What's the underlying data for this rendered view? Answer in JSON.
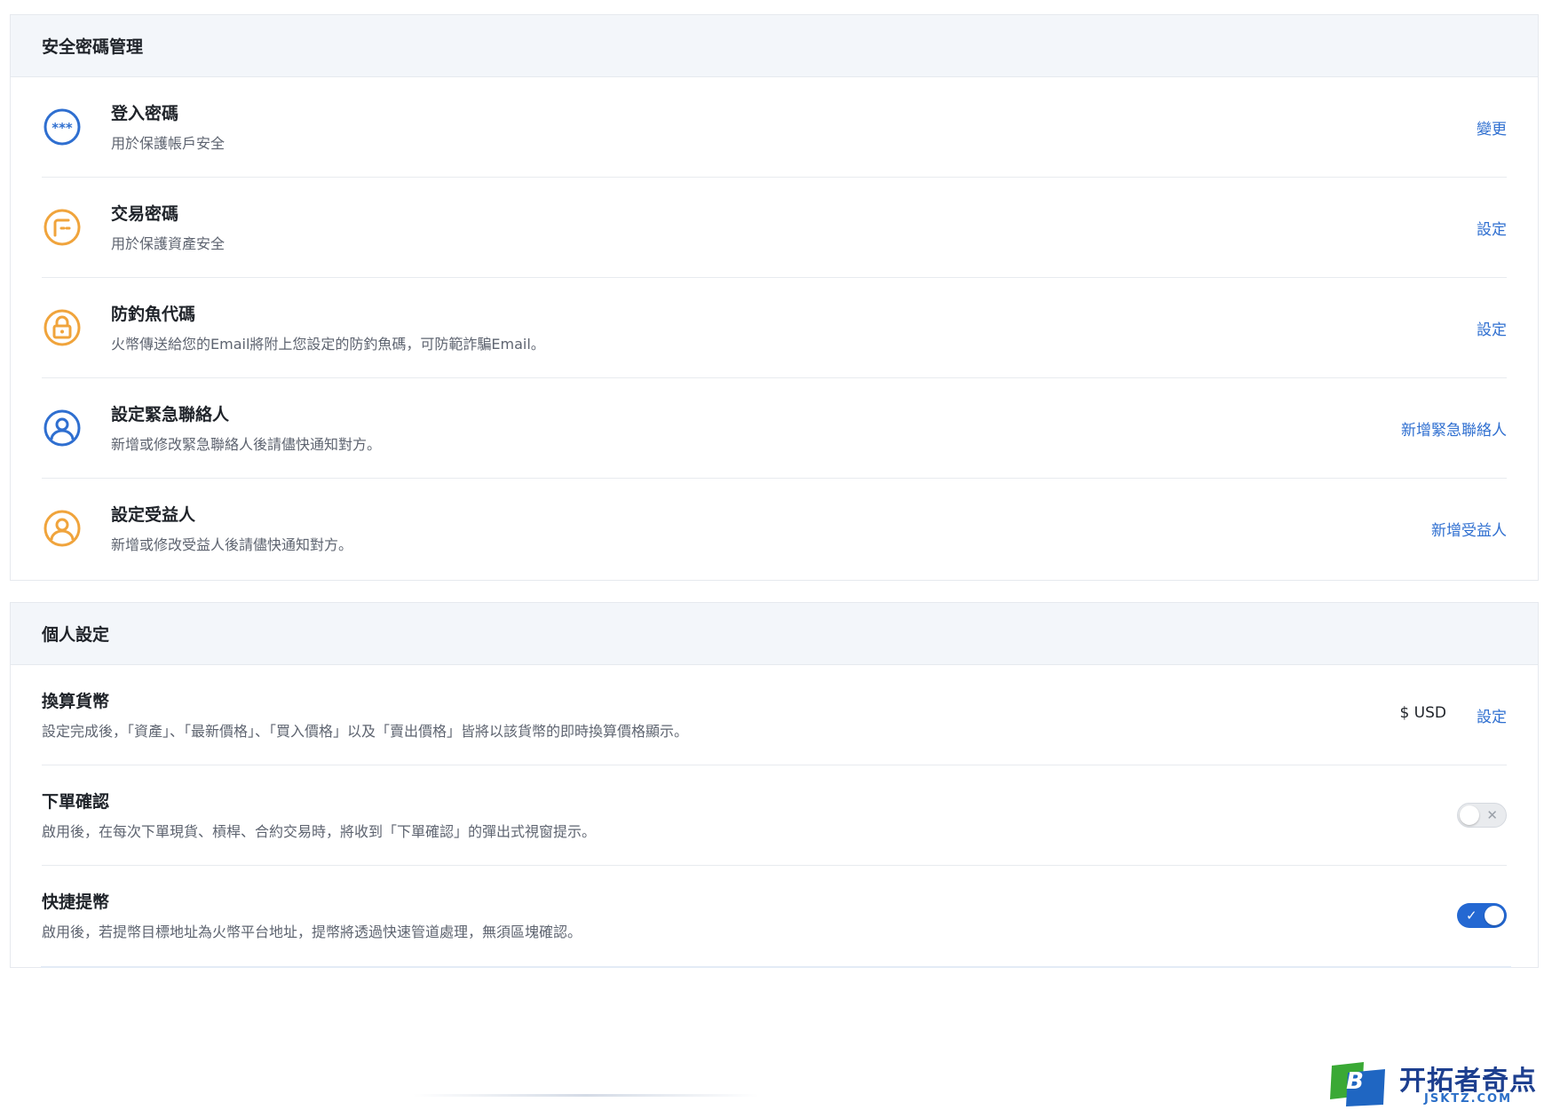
{
  "security": {
    "title": "安全密碼管理",
    "rows": [
      {
        "icon": "password-stars-icon",
        "title": "登入密碼",
        "desc": "用於保護帳戶安全",
        "action": "變更"
      },
      {
        "icon": "trade-password-icon",
        "title": "交易密碼",
        "desc": "用於保護資產安全",
        "action": "設定"
      },
      {
        "icon": "lock-icon",
        "title": "防釣魚代碼",
        "desc": "火幣傳送給您的Email將附上您設定的防釣魚碼，可防範詐騙Email。",
        "action": "設定"
      },
      {
        "icon": "user-icon",
        "title": "設定緊急聯絡人",
        "desc": "新增或修改緊急聯絡人後請儘快通知對方。",
        "action": "新增緊急聯絡人"
      },
      {
        "icon": "user-icon",
        "title": "設定受益人",
        "desc": "新增或修改受益人後請儘快通知對方。",
        "action": "新增受益人"
      }
    ]
  },
  "personal": {
    "title": "個人設定",
    "currency": {
      "title": "換算貨幣",
      "desc": "設定完成後，「資產」、「最新價格」、「買入價格」以及「賣出價格」皆將以該貨幣的即時換算價格顯示。",
      "value": "$ USD",
      "action": "設定"
    },
    "order_confirm": {
      "title": "下單確認",
      "desc": "啟用後，在每次下單現貨、槓桿、合約交易時，將收到「下單確認」的彈出式視窗提示。",
      "enabled": false,
      "mark": "✕"
    },
    "quick_withdraw": {
      "title": "快捷提幣",
      "desc": "啟用後，若提幣目標地址為火幣平台地址，提幣將透過快速管道處理，無須區塊確認。",
      "enabled": true,
      "mark": "✓"
    }
  },
  "watermark": {
    "logo_letter": "B",
    "name": "开拓者奇点",
    "site": "JSKTZ.COM"
  },
  "colors": {
    "accent_blue": "#2f6fd0",
    "icon_blue": "#2f6fd0",
    "icon_orange": "#f0a43c",
    "toggle_on": "#2468d2",
    "header_bg": "#f3f6fa"
  }
}
